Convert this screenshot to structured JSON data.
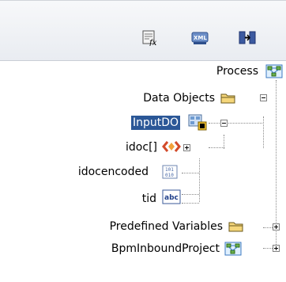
{
  "toolbar": {
    "buttons": [
      {
        "icon": "function-icon"
      },
      {
        "icon": "xml-icon"
      },
      {
        "icon": "mapping-icon"
      }
    ]
  },
  "tree": {
    "nodes": [
      {
        "label": "Process",
        "icon": "process-icon"
      },
      {
        "label": "Data Objects",
        "icon": "folder-icon"
      },
      {
        "label": "InputDO",
        "icon": "data-object-icon",
        "selected": true
      },
      {
        "label": "idoc[]",
        "icon": "array-icon"
      },
      {
        "label": "idocencoded",
        "icon": "binary-icon"
      },
      {
        "label": "tid",
        "icon": "string-icon",
        "icon_text": "abc"
      },
      {
        "label": "Predefined Variables",
        "icon": "folder-icon"
      },
      {
        "label": "BpmInboundProject",
        "icon": "process-icon"
      }
    ]
  },
  "colors": {
    "selection": "#2b5797",
    "toolbar_bg": "#e9ecf1"
  }
}
